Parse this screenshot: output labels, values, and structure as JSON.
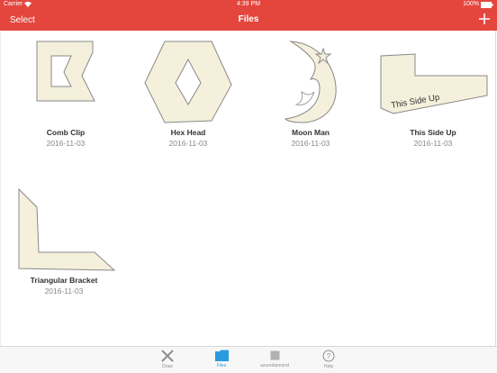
{
  "status_bar": {
    "carrier": "Carrier",
    "time": "4:39 PM",
    "battery": "100%"
  },
  "nav": {
    "select_label": "Select",
    "title": "Files",
    "add_icon": "plus-icon"
  },
  "files": [
    {
      "name": "Comb Clip",
      "date": "2016-11-03",
      "thumbnail_text": ""
    },
    {
      "name": "Hex Head",
      "date": "2016-11-03",
      "thumbnail_text": ""
    },
    {
      "name": "Moon Man",
      "date": "2016-11-03",
      "thumbnail_text": ""
    },
    {
      "name": "This Side Up",
      "date": "2016-11-03",
      "thumbnail_text": "This Side Up"
    },
    {
      "name": "Triangular Bracket",
      "date": "2016-11-03",
      "thumbnail_text": ""
    }
  ],
  "tabs": [
    {
      "label": "Draw",
      "icon": "draw-tools-icon",
      "active": false
    },
    {
      "label": "Files",
      "icon": "folder-icon",
      "active": true
    },
    {
      "label": "azurediamond",
      "icon": "account-square-icon",
      "active": false
    },
    {
      "label": "Help",
      "icon": "help-icon",
      "active": false
    }
  ],
  "colors": {
    "accent": "#e4463e",
    "tab_active": "#2b9be0",
    "shape_fill": "#f5f0dc",
    "shape_stroke": "#888888"
  }
}
